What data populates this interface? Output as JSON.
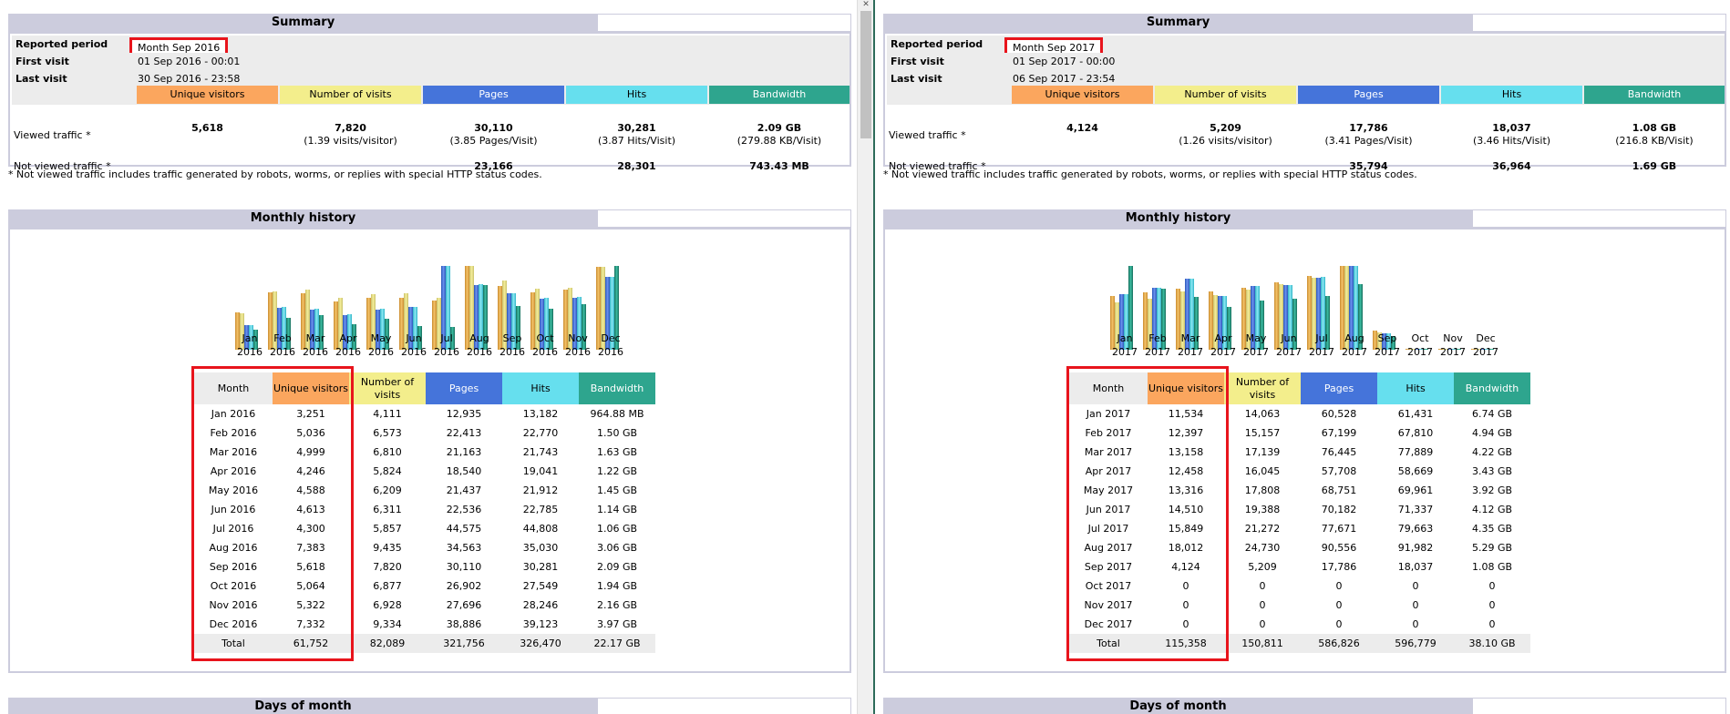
{
  "labels": {
    "summary_title": "Summary",
    "monthly_title": "Monthly history",
    "days_title": "Days of month",
    "reported_period": "Reported period",
    "first_visit": "First visit",
    "last_visit": "Last visit",
    "viewed_traffic": "Viewed traffic *",
    "not_viewed_traffic": "Not viewed traffic *",
    "note": "* Not viewed traffic includes traffic generated by robots, worms, or replies with special HTTP status codes.",
    "col_unique_visitors": "Unique visitors",
    "col_visits": "Number of visits",
    "col_pages": "Pages",
    "col_hits": "Hits",
    "col_bandwidth": "Bandwidth",
    "col_month": "Month",
    "col_unique_visitors_2l": "Unique visitors",
    "col_visits_2l": "Number of visits",
    "total": "Total"
  },
  "colors": {
    "visitors": "#fba65e",
    "visits": "#f3ee8c",
    "pages": "#4574da",
    "hits": "#66dfee",
    "bandwidth": "#2ea58e",
    "highlight": "#e8141c",
    "title_bg": "#ccccdd"
  },
  "reports": [
    {
      "period": "Month Sep 2016",
      "first_visit": "01 Sep 2016 - 00:01",
      "last_visit": "30 Sep 2016 - 23:58",
      "viewed": {
        "visitors": "5,618",
        "visits": "7,820",
        "visits_sub": "(1.39 visits/visitor)",
        "pages": "30,110",
        "pages_sub": "(3.85 Pages/Visit)",
        "hits": "30,281",
        "hits_sub": "(3.87 Hits/Visit)",
        "bandwidth": "2.09 GB",
        "bandwidth_sub": "(279.88 KB/Visit)"
      },
      "not_viewed": {
        "pages": "23,166",
        "hits": "28,301",
        "bandwidth": "743.43 MB"
      },
      "chart_labels": [
        [
          "Jan",
          "2016"
        ],
        [
          "Feb",
          "2016"
        ],
        [
          "Mar",
          "2016"
        ],
        [
          "Apr",
          "2016"
        ],
        [
          "May",
          "2016"
        ],
        [
          "Jun",
          "2016"
        ],
        [
          "Jul",
          "2016"
        ],
        [
          "Aug",
          "2016"
        ],
        [
          "Sep",
          "2016"
        ],
        [
          "Oct",
          "2016"
        ],
        [
          "Nov",
          "2016"
        ],
        [
          "Dec",
          "2016"
        ]
      ],
      "months": [
        [
          "Jan 2016",
          "3,251",
          "4,111",
          "12,935",
          "13,182",
          "964.88 MB"
        ],
        [
          "Feb 2016",
          "5,036",
          "6,573",
          "22,413",
          "22,770",
          "1.50 GB"
        ],
        [
          "Mar 2016",
          "4,999",
          "6,810",
          "21,163",
          "21,743",
          "1.63 GB"
        ],
        [
          "Apr 2016",
          "4,246",
          "5,824",
          "18,540",
          "19,041",
          "1.22 GB"
        ],
        [
          "May 2016",
          "4,588",
          "6,209",
          "21,437",
          "21,912",
          "1.45 GB"
        ],
        [
          "Jun 2016",
          "4,613",
          "6,311",
          "22,536",
          "22,785",
          "1.14 GB"
        ],
        [
          "Jul 2016",
          "4,300",
          "5,857",
          "44,575",
          "44,808",
          "1.06 GB"
        ],
        [
          "Aug 2016",
          "7,383",
          "9,435",
          "34,563",
          "35,030",
          "3.06 GB"
        ],
        [
          "Sep 2016",
          "5,618",
          "7,820",
          "30,110",
          "30,281",
          "2.09 GB"
        ],
        [
          "Oct 2016",
          "5,064",
          "6,877",
          "26,902",
          "27,549",
          "1.94 GB"
        ],
        [
          "Nov 2016",
          "5,322",
          "6,928",
          "27,696",
          "28,246",
          "2.16 GB"
        ],
        [
          "Dec 2016",
          "7,332",
          "9,334",
          "38,886",
          "39,123",
          "3.97 GB"
        ]
      ],
      "total": [
        "Total",
        "61,752",
        "82,089",
        "321,756",
        "326,470",
        "22.17 GB"
      ]
    },
    {
      "period": "Month Sep 2017",
      "first_visit": "01 Sep 2017 - 00:00",
      "last_visit": "06 Sep 2017 - 23:54",
      "viewed": {
        "visitors": "4,124",
        "visits": "5,209",
        "visits_sub": "(1.26 visits/visitor)",
        "pages": "17,786",
        "pages_sub": "(3.41 Pages/Visit)",
        "hits": "18,037",
        "hits_sub": "(3.46 Hits/Visit)",
        "bandwidth": "1.08 GB",
        "bandwidth_sub": "(216.8 KB/Visit)"
      },
      "not_viewed": {
        "pages": "35,794",
        "hits": "36,964",
        "bandwidth": "1.69 GB"
      },
      "chart_labels": [
        [
          "Jan",
          "2017"
        ],
        [
          "Feb",
          "2017"
        ],
        [
          "Mar",
          "2017"
        ],
        [
          "Apr",
          "2017"
        ],
        [
          "May",
          "2017"
        ],
        [
          "Jun",
          "2017"
        ],
        [
          "Jul",
          "2017"
        ],
        [
          "Aug",
          "2017"
        ],
        [
          "Sep",
          "2017"
        ],
        [
          "Oct",
          "2017"
        ],
        [
          "Nov",
          "2017"
        ],
        [
          "Dec",
          "2017"
        ]
      ],
      "months": [
        [
          "Jan 2017",
          "11,534",
          "14,063",
          "60,528",
          "61,431",
          "6.74 GB"
        ],
        [
          "Feb 2017",
          "12,397",
          "15,157",
          "67,199",
          "67,810",
          "4.94 GB"
        ],
        [
          "Mar 2017",
          "13,158",
          "17,139",
          "76,445",
          "77,889",
          "4.22 GB"
        ],
        [
          "Apr 2017",
          "12,458",
          "16,045",
          "57,708",
          "58,669",
          "3.43 GB"
        ],
        [
          "May 2017",
          "13,316",
          "17,808",
          "68,751",
          "69,961",
          "3.92 GB"
        ],
        [
          "Jun 2017",
          "14,510",
          "19,388",
          "70,182",
          "71,337",
          "4.12 GB"
        ],
        [
          "Jul 2017",
          "15,849",
          "21,272",
          "77,671",
          "79,663",
          "4.35 GB"
        ],
        [
          "Aug 2017",
          "18,012",
          "24,730",
          "90,556",
          "91,982",
          "5.29 GB"
        ],
        [
          "Sep 2017",
          "4,124",
          "5,209",
          "17,786",
          "18,037",
          "1.08 GB"
        ],
        [
          "Oct 2017",
          "0",
          "0",
          "0",
          "0",
          "0"
        ],
        [
          "Nov 2017",
          "0",
          "0",
          "0",
          "0",
          "0"
        ],
        [
          "Dec 2017",
          "0",
          "0",
          "0",
          "0",
          "0"
        ]
      ],
      "total": [
        "Total",
        "115,358",
        "150,811",
        "586,826",
        "596,779",
        "38.10 GB"
      ]
    }
  ]
}
